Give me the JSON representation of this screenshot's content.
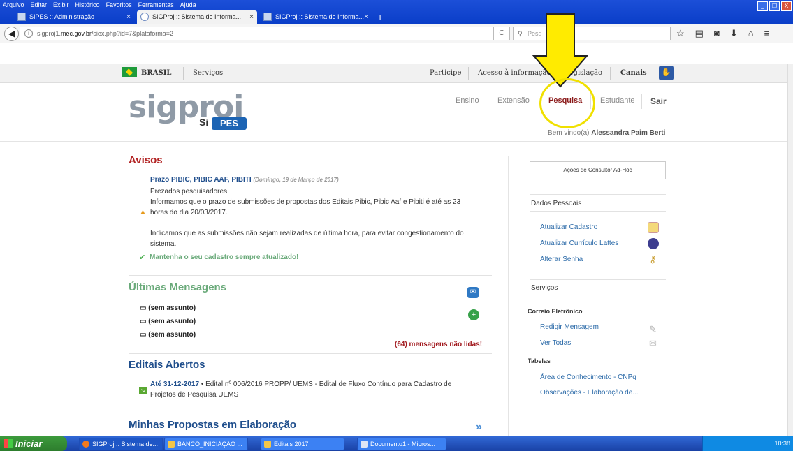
{
  "browser": {
    "menu": [
      "Arquivo",
      "Editar",
      "Exibir",
      "Histórico",
      "Favoritos",
      "Ferramentas",
      "Ajuda"
    ],
    "tabs": [
      {
        "label": "SIPES :: Administração",
        "close": "×"
      },
      {
        "label": "SIGProj :: Sistema de Informa...",
        "close": "×"
      },
      {
        "label": "SIGProj :: Sistema de Informa...",
        "close": "×"
      }
    ],
    "new_tab": "+",
    "url_host": "sigproj1.mec.gov.br",
    "url_prefix": "sigproj1.",
    "url_domain": "mec.gov.br",
    "url_path": "/siex.php?id=7&plataforma=2",
    "search_placeholder": "Pesq",
    "window_buttons": [
      "_",
      "❐",
      "X"
    ]
  },
  "govbar": {
    "brasil": "BRASIL",
    "servicos": "Serviços",
    "participe": "Participe",
    "acesso": "Acesso à informação",
    "legislacao": "Legislação",
    "canais": "Canais"
  },
  "header": {
    "logo": "sigproj",
    "si": "Si",
    "pes": "PES",
    "nav": [
      "Ensino",
      "Extensão",
      "Pesquisa",
      "Estudante"
    ],
    "sair": "Sair",
    "welcome_prefix": "Bem vindo(a)",
    "welcome_name": "Alessandra Paim Berti"
  },
  "avisos": {
    "title": "Avisos",
    "item_title": "Prazo PIBIC, PIBIC AAF, PIBITI",
    "item_date": "(Domingo, 19 de Março de 2017)",
    "line1": "Prezados pesquisadores,",
    "line2": "Informamos que o prazo de submissões de propostas dos Editais Pibic, Pibic Aaf e Pibiti é até as 23",
    "line3": "horas do dia 20/03/2017.",
    "line4": "Indicamos que as submissões não sejam realizadas de última hora, para evitar congestionamento do",
    "line5": "sistema.",
    "keep_updated": "Mantenha o seu cadastro sempre atualizado!"
  },
  "mensagens": {
    "title": "Últimas Mensagens",
    "items": [
      "(sem assunto)",
      "(sem assunto)",
      "(sem assunto)"
    ],
    "unread": "(64) mensagens não lidas!"
  },
  "editais": {
    "title": "Editais Abertos",
    "date": "Até 31-12-2017",
    "text1": " • Edital nº 006/2016 PROPP/ UEMS - Edital de Fluxo Contínuo para Cadastro de",
    "text2": "Projetos de Pesquisa UEMS"
  },
  "propostas": {
    "title": "Minhas Propostas em Elaboração",
    "more": "»"
  },
  "sidebar": {
    "adhoc": "Ações de Consultor Ad-Hoc",
    "dados_title": "Dados Pessoais",
    "dados_links": [
      "Atualizar Cadastro",
      "Atualizar Currículo Lattes",
      "Alterar Senha"
    ],
    "servicos_title": "Serviços",
    "correio_title": "Correio Eletrônico",
    "correio_links": [
      "Redigir Mensagem",
      "Ver Todas"
    ],
    "tabelas_title": "Tabelas",
    "tabelas_links": [
      "Área de Conhecimento - CNPq",
      "Observações - Elaboração de..."
    ]
  },
  "taskbar": {
    "start": "Iniciar",
    "tasks": [
      "SIGProj :: Sistema de...",
      "BANCO_INICIAÇÃO ...",
      "Editais 2017",
      "Documento1 - Micros..."
    ],
    "clock": "10:38"
  },
  "colors": {
    "accent_red": "#b22222",
    "link_blue": "#2b6aa8",
    "highlight_yellow": "#f0e000"
  }
}
